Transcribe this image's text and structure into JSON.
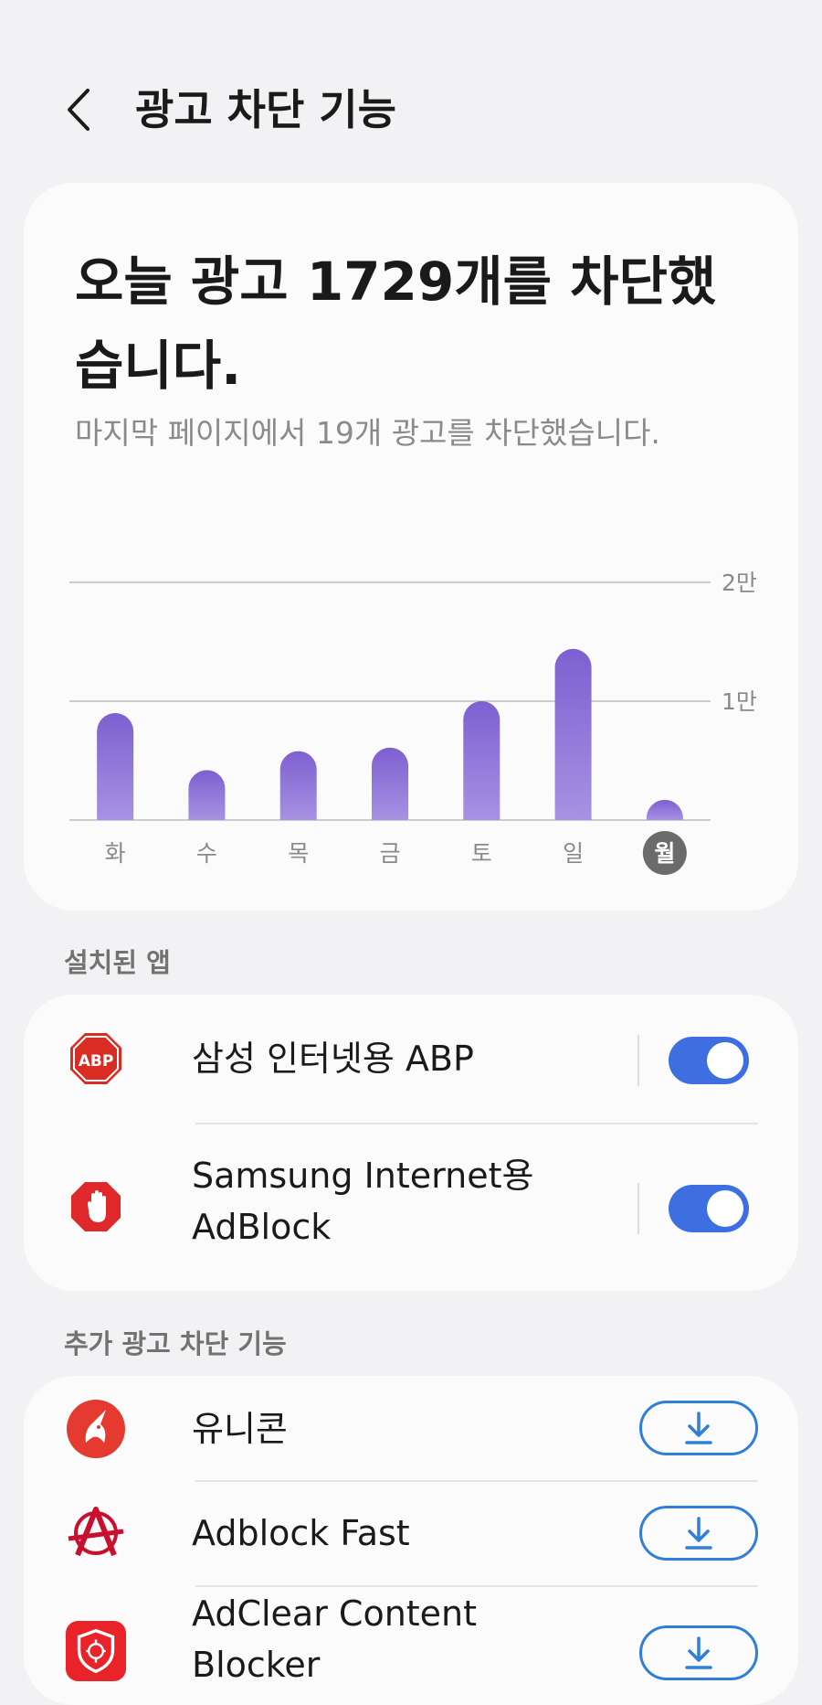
{
  "header": {
    "title": "광고 차단 기능"
  },
  "summary": {
    "title": "오늘 광고 1729개를 차단했습니다.",
    "subtitle": "마지막 페이지에서 19개 광고를 차단했습니다."
  },
  "chart_data": {
    "type": "bar",
    "categories": [
      "화",
      "수",
      "목",
      "금",
      "토",
      "일",
      "월"
    ],
    "values": [
      9000,
      4200,
      5800,
      6100,
      10000,
      14400,
      1700
    ],
    "y_tick_labels": [
      "1만",
      "2만"
    ],
    "y_ticks": [
      10000,
      20000
    ],
    "ylim": [
      0,
      20000
    ],
    "grid": true,
    "selected_category": "월",
    "bar_color_top": "#7e5fd0",
    "bar_color_bottom": "#a792e3",
    "selected_badge_color": "#6b6b6b"
  },
  "installed": {
    "label": "설치된 앱",
    "items": [
      {
        "name": "삼성 인터넷용 ABP",
        "icon": "abp-icon",
        "enabled": true
      },
      {
        "name_line1": "Samsung Internet용",
        "name_line2": "AdBlock",
        "icon": "hand-stop-icon",
        "enabled": true
      }
    ]
  },
  "extra": {
    "label": "추가 광고 차단 기능",
    "items": [
      {
        "name": "유니콘",
        "icon": "unicorn-icon"
      },
      {
        "name": "Adblock Fast",
        "icon": "anarchy-a-icon"
      },
      {
        "name_line1": "AdClear Content",
        "name_line2": "Blocker",
        "icon": "adclear-shield-icon"
      }
    ]
  },
  "colors": {
    "accent": "#3e6fe0",
    "download_outline": "#2f7fd8",
    "abp_red": "#d92d24",
    "unicorn_red": "#e53a2f"
  }
}
